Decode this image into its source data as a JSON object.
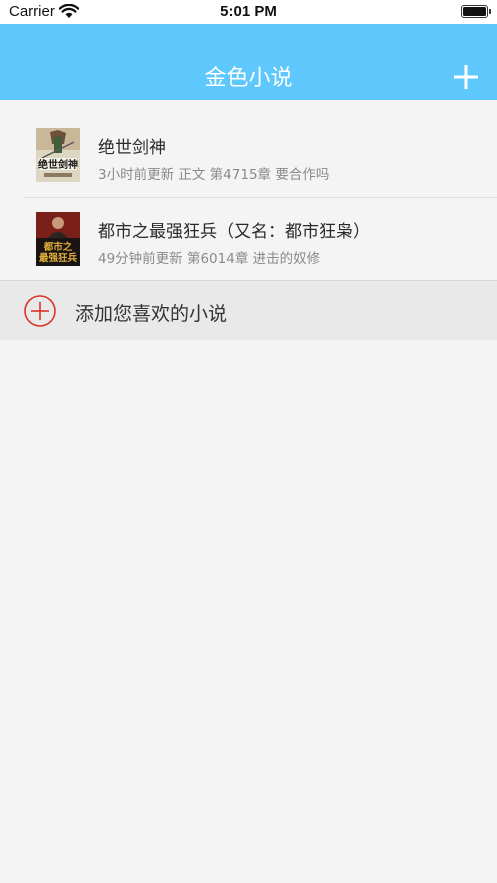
{
  "status_bar": {
    "carrier": "Carrier",
    "time": "5:01 PM",
    "wifi_icon": "wifi-icon",
    "battery_icon": "battery-icon"
  },
  "nav": {
    "title": "金色小说",
    "add_icon": "plus-icon"
  },
  "novels": [
    {
      "title": "绝世剑神",
      "meta": "3小时前更新 正文 第4715章 要合作吗"
    },
    {
      "title": "都市之最强狂兵（又名：都市狂枭）",
      "meta": "49分钟前更新 第6014章 进击的奴修"
    }
  ],
  "add_row": {
    "label": "添加您喜欢的小说",
    "icon": "plus-circle-icon"
  },
  "colors": {
    "nav_bg": "#5ec8fc",
    "page_bg": "#f4f4f4",
    "add_icon": "#d9342b"
  }
}
